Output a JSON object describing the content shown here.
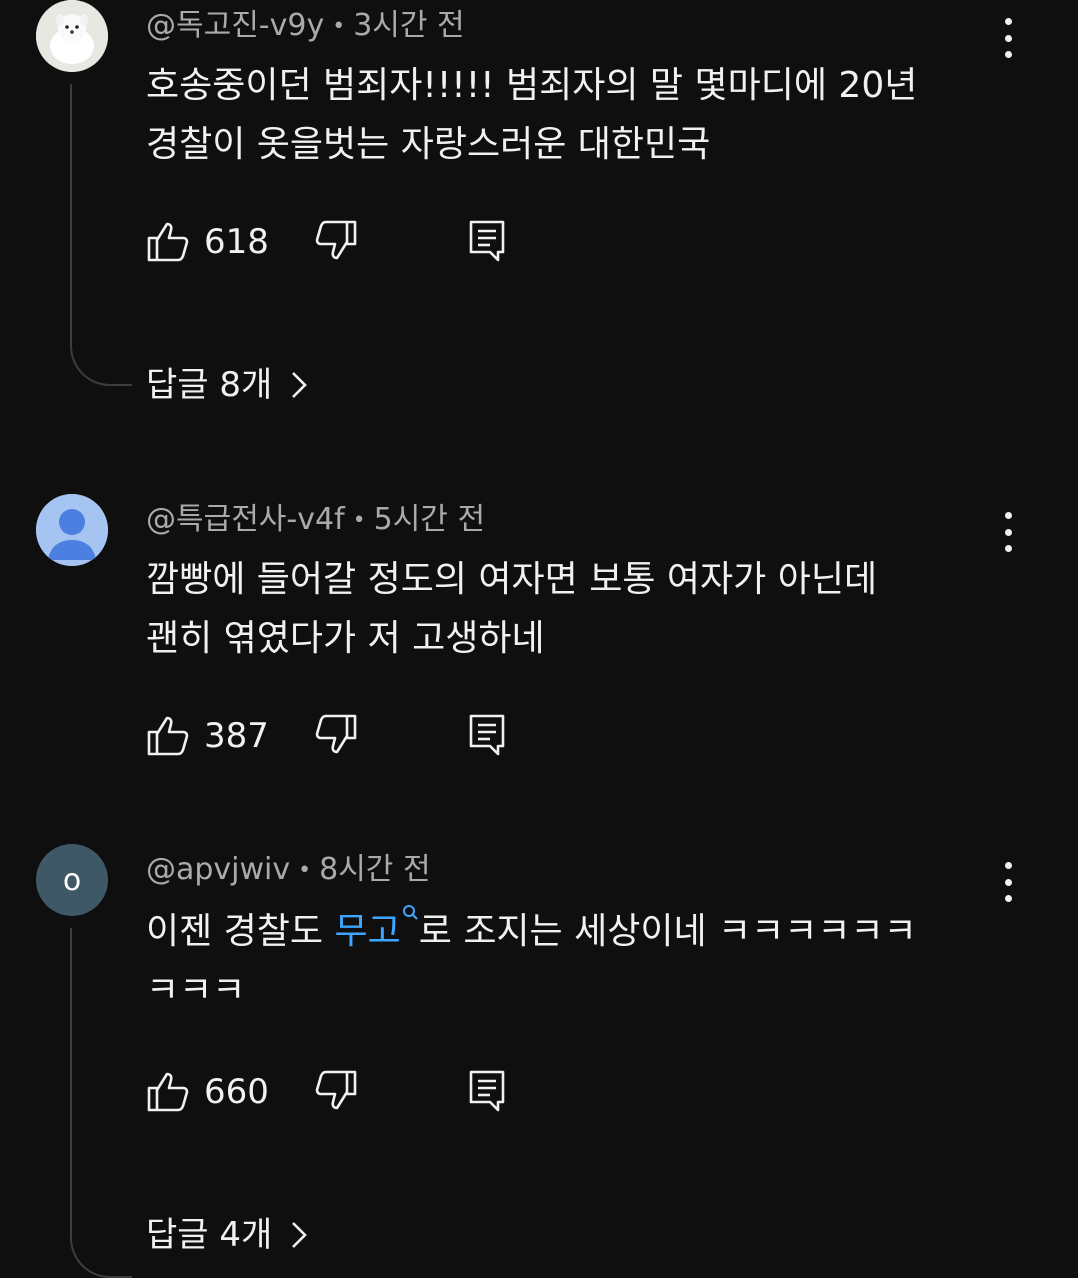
{
  "comments": [
    {
      "author": "@독고진-v9y",
      "time": "3시간 전",
      "avatar": "dog-photo",
      "text_line1": "호송중이던 범죄자!!!!! 범죄자의 말 몇마디에 20년",
      "text_line2": "경찰이 옷을벗는 자랑스러운 대한민국",
      "likes": "618",
      "replies": "답글 8개"
    },
    {
      "author": "@특급전사-v4f",
      "time": "5시간 전",
      "avatar": "default-person",
      "text_line1": "깜빵에 들어갈 정도의 여자면 보통 여자가 아닌데",
      "text_line2": "괜히 엮였다가 저 고생하네",
      "likes": "387"
    },
    {
      "author": "@apvjwiv",
      "time": "8시간 전",
      "avatar_letter": "o",
      "text_pre": "이젠 경찰도 ",
      "text_link": "무고",
      "text_post": "로 조지는 세상이네 ㅋㅋㅋㅋㅋㅋ",
      "text_line2": "ㅋㅋㅋ",
      "likes": "660",
      "replies": "답글 4개"
    }
  ],
  "separator": "•",
  "colors": {
    "background": "#0f0f0f",
    "text": "#f1f1f1",
    "meta": "#aaaaaa",
    "link": "#3ea6ff"
  },
  "icons": [
    "thumbs-up-icon",
    "thumbs-down-icon",
    "reply-icon",
    "more-vert-icon",
    "chevron-right-icon",
    "search-icon"
  ]
}
